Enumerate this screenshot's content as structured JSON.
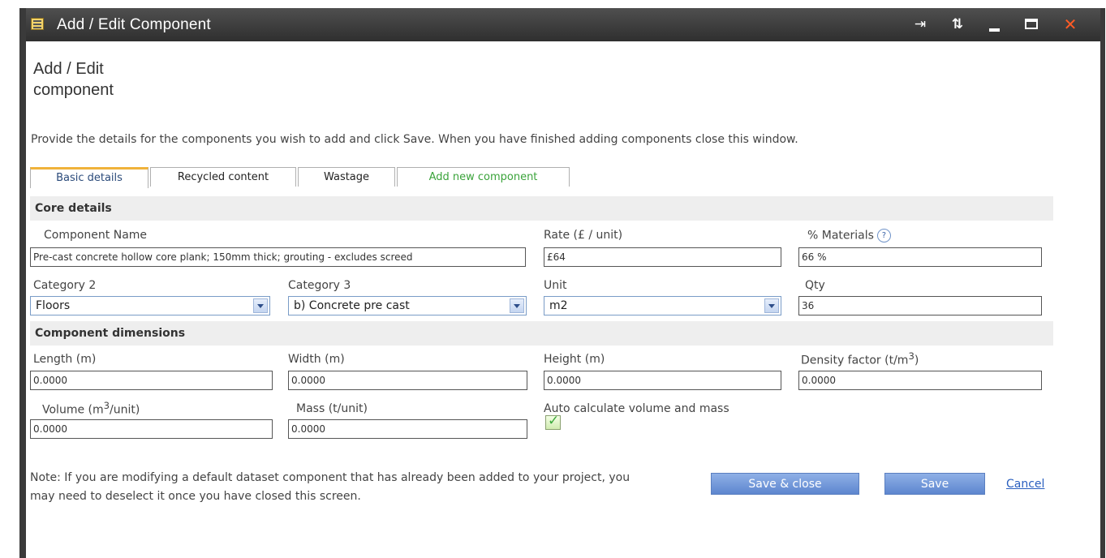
{
  "window": {
    "title": "Add / Edit Component",
    "controls": [
      "pin-icon",
      "refresh-icon",
      "minimize-icon",
      "maximize-icon",
      "close-icon"
    ]
  },
  "page": {
    "heading": "Add / Edit component",
    "intro": "Provide the details for the components you wish to add and click Save. When you have finished adding components close this window."
  },
  "tabs": [
    {
      "label": "Basic details",
      "active": true
    },
    {
      "label": "Recycled content",
      "active": false
    },
    {
      "label": "Wastage",
      "active": false
    },
    {
      "label": "Add new component",
      "active": false
    }
  ],
  "core": {
    "section_title": "Core details",
    "component_name": {
      "label": "Component Name",
      "value": "Pre-cast concrete hollow core plank; 150mm thick; grouting - excludes screed"
    },
    "rate": {
      "label": "Rate (£ / unit)",
      "value": "£64"
    },
    "materials": {
      "label": "% Materials",
      "value": "66 %",
      "help": "?"
    },
    "category2": {
      "label": "Category 2",
      "value": "Floors"
    },
    "category3": {
      "label": "Category 3",
      "value": "b) Concrete pre cast"
    },
    "unit": {
      "label": "Unit",
      "value": "m2"
    },
    "qty": {
      "label": "Qty",
      "value": "36"
    }
  },
  "dimensions": {
    "section_title": "Component dimensions",
    "length": {
      "label": "Length (m)",
      "value": "0.0000"
    },
    "width": {
      "label": "Width (m)",
      "value": "0.0000"
    },
    "height": {
      "label": "Height (m)",
      "value": "0.0000"
    },
    "density": {
      "label_prefix": "Density factor (t/m",
      "label_sup": "3",
      "label_suffix": ")",
      "value": "0.0000"
    },
    "volume": {
      "label_prefix": "Volume (m",
      "label_sup": "3",
      "label_suffix": "/unit)",
      "value": "0.0000"
    },
    "mass": {
      "label": "Mass (t/unit)",
      "value": "0.0000"
    },
    "auto_calc": {
      "label": "Auto calculate volume and mass",
      "checked": true
    }
  },
  "footer": {
    "note": "Note: If you are modifying a default dataset component that has already been added to your project, you may need to deselect it once you have closed this screen.",
    "save_close": "Save & close",
    "save": "Save",
    "cancel": "Cancel"
  },
  "colors": {
    "title_bar": "#3a3a3a",
    "tab_accent": "#f0b23a",
    "button_blue": "#5d86cf",
    "link": "#2a5fbf",
    "close_icon": "#ff5b25"
  }
}
